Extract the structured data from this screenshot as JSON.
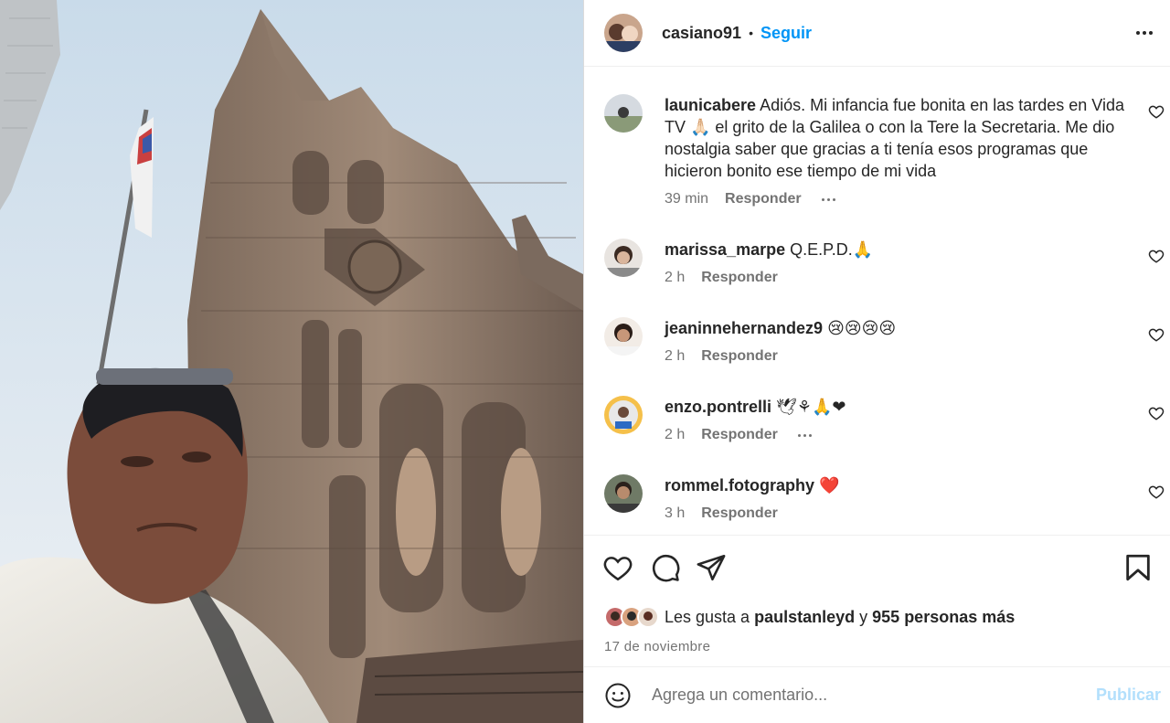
{
  "post": {
    "author": "casiano91",
    "separator": "•",
    "follow_label": "Seguir"
  },
  "comments": [
    {
      "username": "launicabere",
      "text": "Adiós. Mi infancia fue bonita en las tardes en Vida TV 🙏🏻 el grito de la Galilea o con la Tere la Secretaria. Me dio nostalgia saber que gracias a ti tenía esos programas que hicieron bonito ese tiempo de mi vida",
      "time": "39 min",
      "reply_label": "Responder"
    },
    {
      "username": "marissa_marpe",
      "text": "Q.E.P.D.🙏",
      "time": "2 h",
      "reply_label": "Responder"
    },
    {
      "username": "jeaninnehernandez9",
      "text": "😢😢😢😢",
      "time": "2 h",
      "reply_label": "Responder"
    },
    {
      "username": "enzo.pontrelli",
      "text": "🕊⚘🙏❤",
      "time": "2 h",
      "reply_label": "Responder"
    },
    {
      "username": "rommel.fotography",
      "text": "❤️",
      "time": "3 h",
      "reply_label": "Responder"
    }
  ],
  "likes": {
    "prefix": "Les gusta a",
    "user": "paulstanleyd",
    "connector": "y",
    "others": "955 personas más"
  },
  "date": "17 de noviembre",
  "composer": {
    "placeholder": "Agrega un comentario...",
    "publish_label": "Publicar"
  },
  "icons": {
    "more": "more-horizontal-icon",
    "like": "heart-icon",
    "comment": "comment-icon",
    "share": "send-icon",
    "save": "bookmark-icon",
    "emoji": "emoji-smiley-icon"
  },
  "colors": {
    "link_blue": "#0095f6",
    "publish_disabled": "#b2dffc",
    "secondary_text": "#737373"
  }
}
